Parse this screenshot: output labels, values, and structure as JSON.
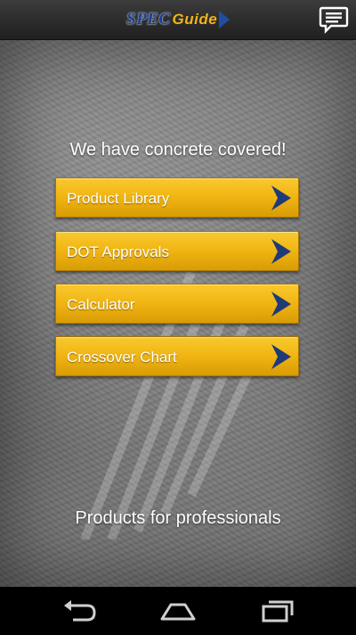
{
  "app": {
    "logo_part1": "SPEC",
    "logo_part2": "Guide"
  },
  "content": {
    "headline": "We have concrete covered!",
    "footer": "Products for professionals"
  },
  "menu": {
    "items": [
      {
        "label": "Product Library"
      },
      {
        "label": "DOT Approvals"
      },
      {
        "label": "Calculator"
      },
      {
        "label": "Crossover Chart"
      }
    ]
  },
  "icons": {
    "chat": "chat-bubble-icon",
    "chevron": "chevron-right-icon",
    "back": "back-icon",
    "home": "home-icon",
    "recents": "recent-apps-icon"
  },
  "colors": {
    "button": "#f1b614",
    "chevron": "#1e3a78",
    "logo_blue": "#1b3f8f",
    "logo_gold": "#f2b318"
  }
}
